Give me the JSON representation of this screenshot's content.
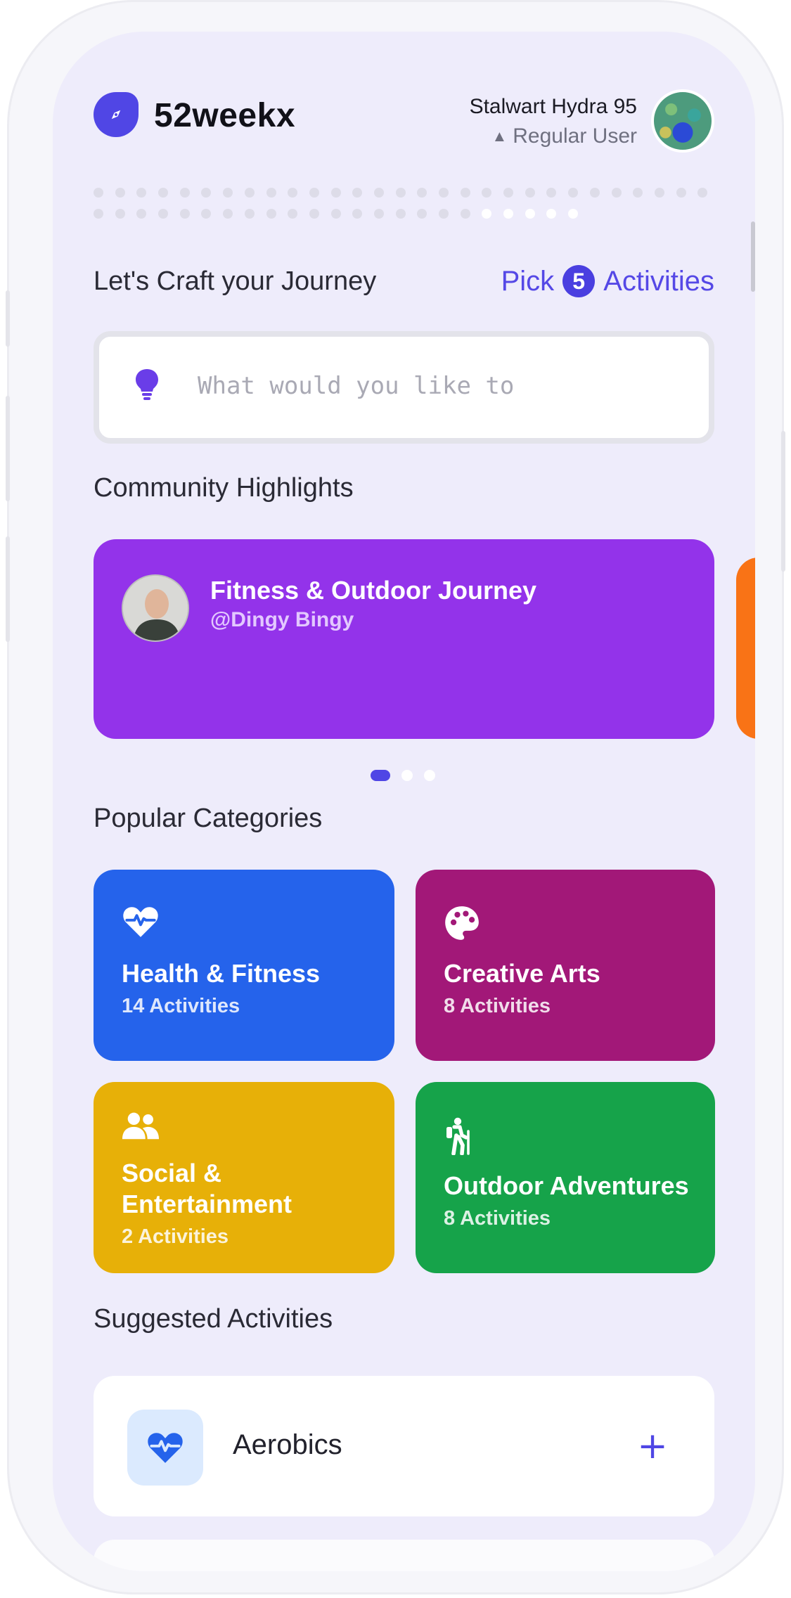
{
  "app": {
    "name": "52weekx"
  },
  "user": {
    "name": "Stalwart Hydra 95",
    "role": "Regular User"
  },
  "progress": {
    "weeks_total": 52,
    "weeks_completed": 5
  },
  "journey": {
    "title": "Let's Craft your Journey",
    "pick_prefix": "Pick",
    "pick_count": "5",
    "pick_suffix": "Activities",
    "search_placeholder": "What would you like to"
  },
  "highlights": {
    "title": "Community Highlights",
    "card": {
      "title": "Fitness & Outdoor Journey",
      "handle": "@Dingy Bingy",
      "color": "#9333ea"
    },
    "next_card_color": "#f97316",
    "pages": 3,
    "active_page": 1
  },
  "categories": {
    "title": "Popular Categories",
    "items": [
      {
        "name": "Health & Fitness",
        "count": "14 Activities",
        "color": "#2563eb",
        "icon": "heart-pulse-icon"
      },
      {
        "name": "Creative Arts",
        "count": "8 Activities",
        "color": "#a21878",
        "icon": "palette-icon"
      },
      {
        "name": "Social & Entertainment",
        "count": "2 Activities",
        "color": "#e7b008",
        "icon": "users-icon"
      },
      {
        "name": "Outdoor Adventures",
        "count": "8 Activities",
        "color": "#16a34a",
        "icon": "hiking-icon"
      }
    ]
  },
  "suggested": {
    "title": "Suggested Activities",
    "items": [
      {
        "name": "Aerobics",
        "icon": "heart-pulse-icon",
        "action": "+"
      }
    ]
  },
  "colors": {
    "accent": "#4f46e5",
    "screen_bg": "#eeecfb"
  }
}
